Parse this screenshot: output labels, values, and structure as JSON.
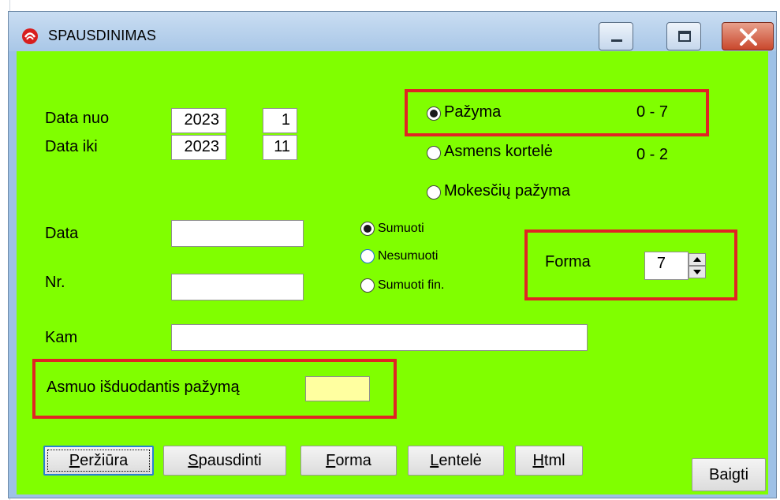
{
  "window": {
    "title": "SPAUSDINIMAS"
  },
  "colors": {
    "client_bg": "#80ff00",
    "highlight_border": "#e02424",
    "yellow_field": "#ffffa0"
  },
  "dates": {
    "from_label": "Data nuo",
    "from_year": "2023",
    "from_month": "1",
    "to_label": "Data iki",
    "to_year": "2023",
    "to_month": "11"
  },
  "doc_type": {
    "options": [
      {
        "label": "Pažyma",
        "range": "0 - 7",
        "selected": true
      },
      {
        "label": "Asmens kortelė",
        "range": "0 - 2",
        "selected": false
      },
      {
        "label": "Mokesčių pažyma",
        "range": "",
        "selected": false
      }
    ]
  },
  "fields": {
    "data_label": "Data",
    "data_value": "",
    "nr_label": "Nr.",
    "nr_value": "",
    "kam_label": "Kam",
    "kam_value": "",
    "person_label": "Asmuo išduodantis pažymą",
    "person_value": ""
  },
  "sum_mode": {
    "options": [
      {
        "label": "Sumuoti",
        "selected": true
      },
      {
        "label": "Nesumuoti",
        "selected": false
      },
      {
        "label": "Sumuoti fin.",
        "selected": false
      }
    ]
  },
  "forma": {
    "label": "Forma",
    "value": "7"
  },
  "buttons": {
    "preview": {
      "first": "P",
      "rest": "eržiūra"
    },
    "print": {
      "first": "S",
      "rest": "pausdinti"
    },
    "form": {
      "first": "F",
      "rest": "orma"
    },
    "table": {
      "first": "L",
      "rest": "entelė"
    },
    "html": {
      "first": "H",
      "rest": "tml"
    },
    "finish": "Baigti"
  }
}
